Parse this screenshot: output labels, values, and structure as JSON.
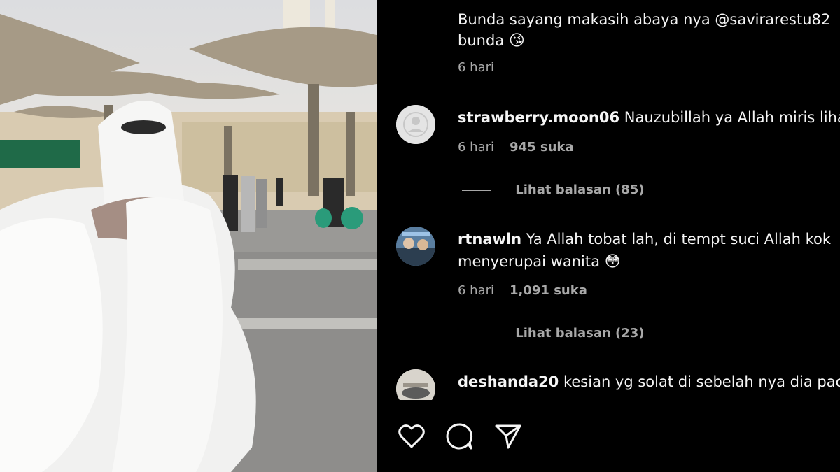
{
  "colors": {
    "background": "#000000",
    "text": "#f5f5f5",
    "secondary": "#a8a8a8",
    "divider": "#262626"
  },
  "photo": {
    "description_icon": "video-frame"
  },
  "comments": [
    {
      "username": "",
      "text_line1": "Bunda sayang makasih abaya nya @savirarestu82",
      "text_line2": "bunda",
      "emoji": "😘",
      "time": "6 hari",
      "likes": ""
    },
    {
      "username": "strawberry.moon06",
      "text_line1": "Nauzubillah ya Allah miris liha",
      "time": "6 hari",
      "likes": "945 suka",
      "replies": "Lihat balasan (85)",
      "avatar_icon": "default-avatar-icon"
    },
    {
      "username": "rtnawln",
      "text_line1": "Ya Allah tobat lah, di tempt suci Allah kok",
      "text_line2": "menyerupai wanita",
      "emoji": "😳",
      "time": "6 hari",
      "likes": "1,091 suka",
      "replies": "Lihat balasan (23)",
      "avatar_icon": "photo-avatar-icon"
    },
    {
      "username": "deshanda20",
      "text_line1": "kesian yg solat di sebelah nya dia pac",
      "avatar_icon": "photo-avatar-icon"
    }
  ],
  "actions": [
    {
      "name": "like",
      "icon": "heart-icon"
    },
    {
      "name": "comment",
      "icon": "comment-icon"
    },
    {
      "name": "share",
      "icon": "send-icon"
    }
  ]
}
